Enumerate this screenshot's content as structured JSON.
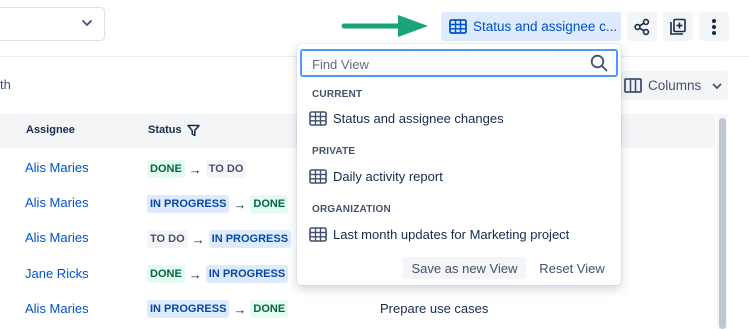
{
  "toolbar": {
    "view_button_label": "Status and assignee c...",
    "accent_color": "#0052cc",
    "arrow_color": "#1ba37a"
  },
  "filter_text_fragment": "th",
  "columns_button_label": "Columns",
  "table": {
    "headers": {
      "assignee": "Assignee",
      "status": "Status"
    },
    "rows": [
      {
        "assignee": "Alis Maries",
        "from": "DONE",
        "from_kind": "done",
        "to": "TO DO",
        "to_kind": "todo",
        "summary": ""
      },
      {
        "assignee": "Alis Maries",
        "from": "IN PROGRESS",
        "from_kind": "progress",
        "to": "DONE",
        "to_kind": "done",
        "summary": ""
      },
      {
        "assignee": "Alis Maries",
        "from": "TO DO",
        "from_kind": "todo",
        "to": "IN PROGRESS",
        "to_kind": "progress",
        "summary": ""
      },
      {
        "assignee": "Jane Ricks",
        "from": "DONE",
        "from_kind": "done",
        "to": "IN PROGRESS",
        "to_kind": "progress",
        "summary": ""
      },
      {
        "assignee": "Alis Maries",
        "from": "IN PROGRESS",
        "from_kind": "progress",
        "to": "DONE",
        "to_kind": "done",
        "summary": "Prepare use cases"
      }
    ]
  },
  "dropdown": {
    "search_placeholder": "Find View",
    "sections": [
      {
        "title": "CURRENT",
        "items": [
          "Status and assignee changes"
        ]
      },
      {
        "title": "PRIVATE",
        "items": [
          "Daily activity report"
        ]
      },
      {
        "title": "ORGANIZATION",
        "items": [
          "Last month updates for Marketing project"
        ]
      }
    ],
    "save_label": "Save as new View",
    "reset_label": "Reset View"
  }
}
